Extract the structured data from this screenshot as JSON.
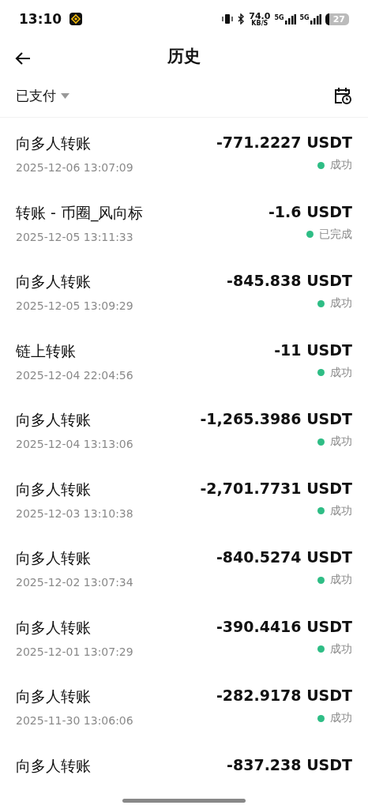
{
  "status_bar": {
    "time": "13:10",
    "net_speed": "74.0",
    "net_unit": "KB/S",
    "signals": [
      "5G",
      "5G"
    ],
    "battery": "27"
  },
  "header": {
    "title": "历史"
  },
  "filter": {
    "label": "已支付"
  },
  "transactions": [
    {
      "title": "向多人转账",
      "date": "2025-12-06 13:07:09",
      "amount": "-771.2227 USDT",
      "status": "成功"
    },
    {
      "title": "转账 - 币圈_风向标",
      "date": "2025-12-05 13:11:33",
      "amount": "-1.6 USDT",
      "status": "已完成"
    },
    {
      "title": "向多人转账",
      "date": "2025-12-05 13:09:29",
      "amount": "-845.838 USDT",
      "status": "成功"
    },
    {
      "title": "链上转账",
      "date": "2025-12-04 22:04:56",
      "amount": "-11 USDT",
      "status": "成功"
    },
    {
      "title": "向多人转账",
      "date": "2025-12-04 13:13:06",
      "amount": "-1,265.3986 USDT",
      "status": "成功"
    },
    {
      "title": "向多人转账",
      "date": "2025-12-03 13:10:38",
      "amount": "-2,701.7731 USDT",
      "status": "成功"
    },
    {
      "title": "向多人转账",
      "date": "2025-12-02 13:07:34",
      "amount": "-840.5274 USDT",
      "status": "成功"
    },
    {
      "title": "向多人转账",
      "date": "2025-12-01 13:07:29",
      "amount": "-390.4416 USDT",
      "status": "成功"
    },
    {
      "title": "向多人转账",
      "date": "2025-11-30 13:06:06",
      "amount": "-282.9178 USDT",
      "status": "成功"
    },
    {
      "title": "向多人转账",
      "amount": "-837.238 USDT"
    }
  ]
}
